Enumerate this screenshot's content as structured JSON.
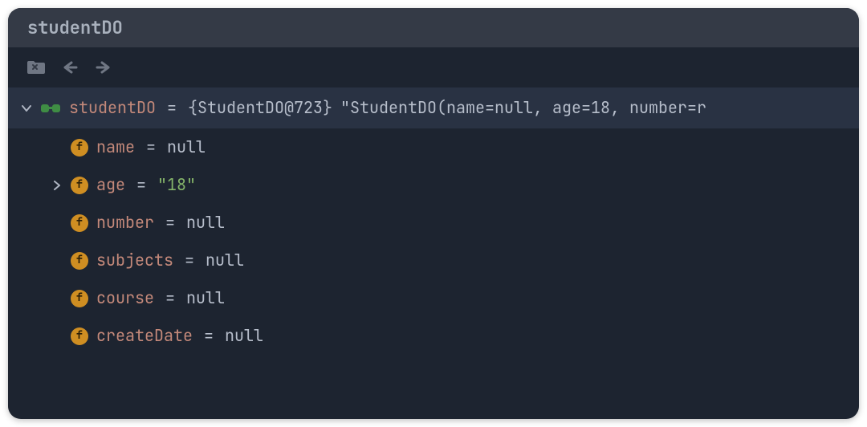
{
  "header": {
    "title": "studentDO"
  },
  "toolbar": {
    "folder_icon": "folder-close-icon",
    "back_icon": "arrow-left-icon",
    "forward_icon": "arrow-right-icon"
  },
  "root": {
    "watch_icon": "watch-glasses-icon",
    "name": "studentDO",
    "type_ref": "{StudentDO@723}",
    "to_string": "\"StudentDO(name=null, age=18, number=r"
  },
  "fields": [
    {
      "expandable": false,
      "name": "name",
      "value": "null",
      "value_kind": "null"
    },
    {
      "expandable": true,
      "name": "age",
      "value": "\"18\"",
      "value_kind": "str"
    },
    {
      "expandable": false,
      "name": "number",
      "value": "null",
      "value_kind": "null"
    },
    {
      "expandable": false,
      "name": "subjects",
      "value": "null",
      "value_kind": "null"
    },
    {
      "expandable": false,
      "name": "course",
      "value": "null",
      "value_kind": "null"
    },
    {
      "expandable": false,
      "name": "createDate",
      "value": "null",
      "value_kind": "null"
    }
  ],
  "glyphs": {
    "eq": " = ",
    "f": "f"
  }
}
